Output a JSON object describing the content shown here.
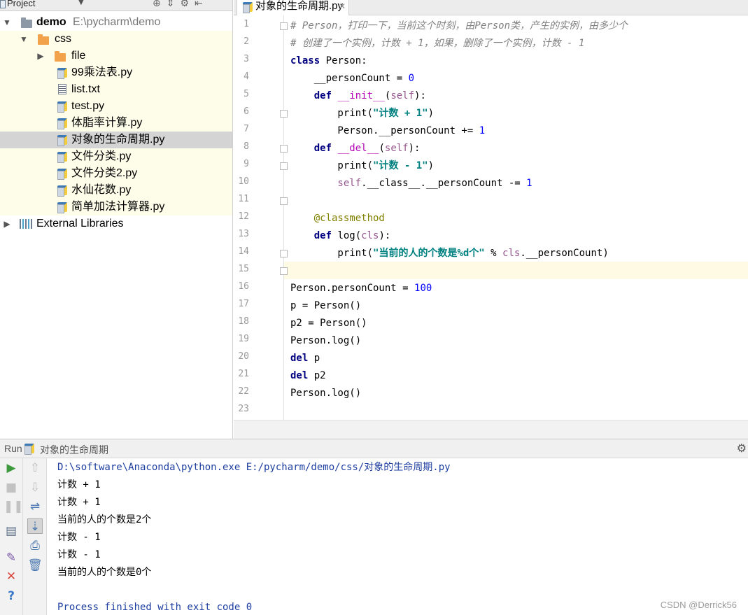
{
  "project": {
    "header_label": "Project",
    "root_name": "demo",
    "root_path": "E:\\pycharm\\demo",
    "items": [
      {
        "label": "css",
        "type": "folder"
      },
      {
        "label": "file",
        "type": "folder"
      },
      {
        "label": "99乘法表.py",
        "type": "py"
      },
      {
        "label": "list.txt",
        "type": "txt"
      },
      {
        "label": "test.py",
        "type": "py"
      },
      {
        "label": "体脂率计算.py",
        "type": "py"
      },
      {
        "label": "对象的生命周期.py",
        "type": "py",
        "selected": true
      },
      {
        "label": "文件分类.py",
        "type": "py"
      },
      {
        "label": "文件分类2.py",
        "type": "py"
      },
      {
        "label": "水仙花数.py",
        "type": "py"
      },
      {
        "label": "简单加法计算器.py",
        "type": "py"
      }
    ],
    "external_libraries": "External Libraries"
  },
  "editor": {
    "tab_label": "对象的生命周期.py",
    "current_line": 15,
    "line_numbers": [
      "1",
      "2",
      "3",
      "4",
      "5",
      "6",
      "7",
      "8",
      "9",
      "10",
      "11",
      "12",
      "13",
      "14",
      "15",
      "16",
      "17",
      "18",
      "19",
      "20",
      "21",
      "22",
      "23"
    ],
    "code": {
      "l1": "# Person，打印一下，当前这个时刻，由Person类，产生的实例，由多少个",
      "l2": "# 创建了一个实例，计数 + 1，如果，删除了一个实例，计数 - 1",
      "l3_kw": "class",
      "l3_rest": " Person:",
      "l4_a": "    __personCount = ",
      "l4_num": "0",
      "l5_kw": "    def",
      "l5_fn": " __init__",
      "l5_a": "(",
      "l5_self": "self",
      "l5_b": "):",
      "l6_a": "        print(",
      "l6_str": "\"计数 + 1\"",
      "l6_b": ")",
      "l7_a": "        Person.__personCount += ",
      "l7_num": "1",
      "l8_kw": "    def",
      "l8_fn": " __del__",
      "l8_a": "(",
      "l8_self": "self",
      "l8_b": "):",
      "l9_a": "        print(",
      "l9_str": "\"计数 - 1\"",
      "l9_b": ")",
      "l10_self": "        self",
      "l10_a": ".__class__.__personCount -= ",
      "l10_num": "1",
      "l12_dec": "    @classmethod",
      "l13_kw": "    def",
      "l13_a": " log(",
      "l13_cls": "cls",
      "l13_b": "):",
      "l14_a": "        print(",
      "l14_str": "\"当前的人的个数是%d个\"",
      "l14_b": " % ",
      "l14_cls": "cls",
      "l14_c": ".__personCount)",
      "l16_a": "Person.personCount = ",
      "l16_num": "100",
      "l17": "p = Person()",
      "l18": "p2 = Person()",
      "l19": "Person.log()",
      "l20_kw": "del",
      "l20_rest": " p",
      "l21_kw": "del",
      "l21_rest": " p2",
      "l22": "Person.log()"
    }
  },
  "run": {
    "label": "Run",
    "config_name": "对象的生命周期",
    "console": [
      "D:\\software\\Anaconda\\python.exe E:/pycharm/demo/css/对象的生命周期.py",
      "计数 + 1",
      "计数 + 1",
      "当前的人的个数是2个",
      "计数 - 1",
      "计数 - 1",
      "当前的人的个数是0个",
      "",
      "Process finished with exit code 0"
    ]
  },
  "watermark": "CSDN @Derrick56",
  "colors": {
    "keyword": "#000080",
    "number": "#0000ff",
    "string": "#008080",
    "comment": "#808080",
    "self": "#94558d",
    "current_line_bg": "#fffae3",
    "selected_row_bg": "#d4d4d4",
    "highlight_row_bg": "#fefde9"
  }
}
